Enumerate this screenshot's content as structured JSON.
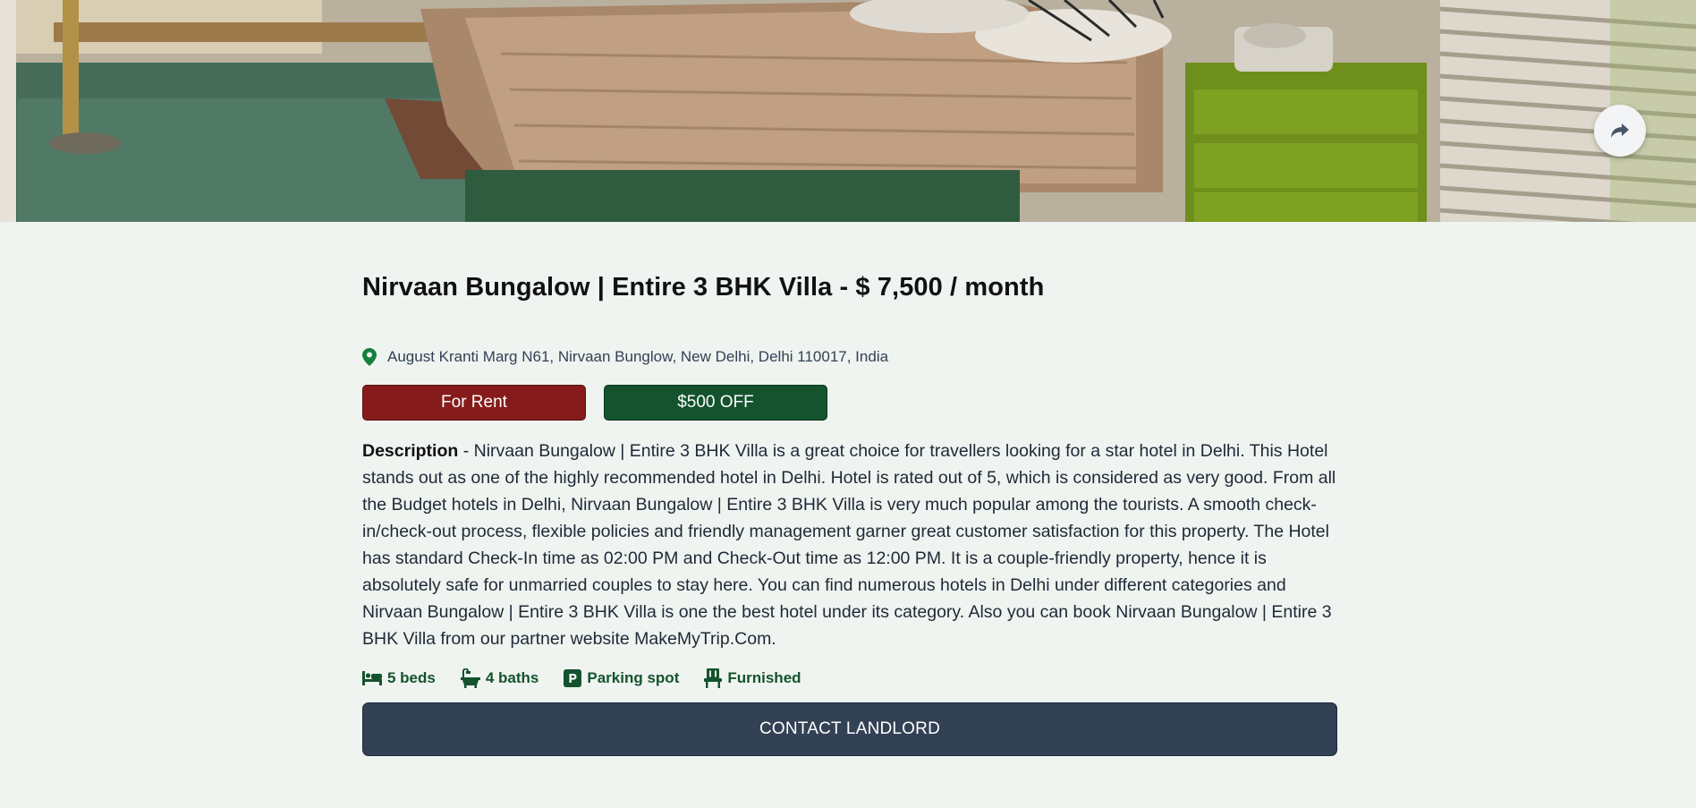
{
  "hero": {
    "alt": "Bedroom photo",
    "share_icon": "share-forward-icon"
  },
  "listing": {
    "title": "Nirvaan Bungalow | Entire 3 BHK Villa - $ 7,500 / month",
    "address": "August Kranti Marg N61, Nirvaan Bunglow, New Delhi, Delhi 110017, India",
    "badges": {
      "rent": "For Rent",
      "discount": "$500 OFF"
    },
    "description_label": "Description",
    "description_text": " - Nirvaan Bungalow | Entire 3 BHK Villa is a great choice for travellers looking for a star hotel in Delhi. This Hotel stands out as one of the highly recommended hotel in Delhi. Hotel is rated out of 5, which is considered as very good. From all the Budget hotels in Delhi, Nirvaan Bungalow | Entire 3 BHK Villa is very much popular among the tourists. A smooth check-in/check-out process, flexible policies and friendly management garner great customer satisfaction for this property. The Hotel has standard Check-In time as 02:00 PM and Check-Out time as 12:00 PM. It is a couple-friendly property, hence it is absolutely safe for unmarried couples to stay here. You can find numerous hotels in Delhi under different categories and Nirvaan Bungalow | Entire 3 BHK Villa is one the best hotel under its category. Also you can book Nirvaan Bungalow | Entire 3 BHK Villa from our partner website MakeMyTrip.Com.",
    "features": {
      "beds": "5 beds",
      "baths": "4 baths",
      "parking": "Parking spot",
      "furnished": "Furnished"
    },
    "contact_label": "CONTACT LANDLORD"
  },
  "colors": {
    "background": "#eff4f0",
    "rent_badge": "#861b1b",
    "discount_badge": "#14532d",
    "feature_text": "#14532d",
    "contact_button": "#334155"
  }
}
